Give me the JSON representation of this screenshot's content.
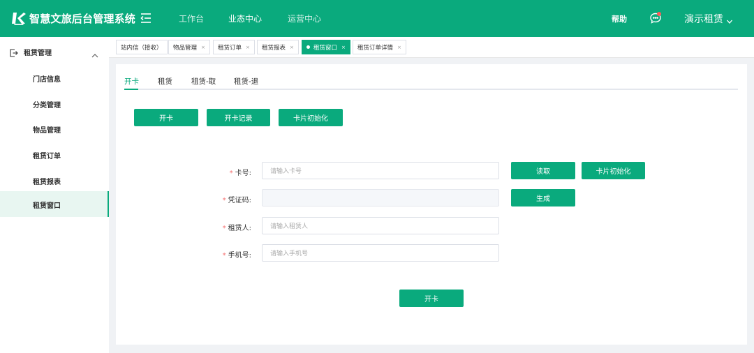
{
  "colors": {
    "brand": "#0aaa7d",
    "required": "#f56c6c",
    "notify_dot": "#ff5a5a"
  },
  "header": {
    "logo_icon": "logo-icon",
    "app_title": "智慧文旅后台管理系统",
    "collapse_icon": "menu-collapse-icon",
    "nav": [
      {
        "label": "工作台"
      },
      {
        "label": "业态中心",
        "active": true
      },
      {
        "label": "运营中心"
      }
    ],
    "help_label": "帮助",
    "message_icon": "message-icon",
    "user_name": "演示租赁",
    "user_caret_icon": "chevron-down-icon"
  },
  "sidebar": {
    "group": {
      "label": "租赁管理",
      "icon": "exit-icon",
      "caret_icon": "chevron-up-icon"
    },
    "items": [
      {
        "label": "门店信息"
      },
      {
        "label": "分类管理"
      },
      {
        "label": "物品管理"
      },
      {
        "label": "租赁订单"
      },
      {
        "label": "租赁报表"
      },
      {
        "label": "租赁窗口",
        "active": true
      }
    ]
  },
  "tabs": [
    {
      "label": "站内信（接收）",
      "closable": false
    },
    {
      "label": "物品管理",
      "closable": true
    },
    {
      "label": "租赁订单",
      "closable": true
    },
    {
      "label": "租赁报表",
      "closable": true
    },
    {
      "label": "租赁窗口",
      "closable": true,
      "active": true
    },
    {
      "label": "租赁订单详情",
      "closable": true
    }
  ],
  "tab_close_glyph": "×",
  "main": {
    "subtabs": [
      {
        "label": "开卡",
        "active": true
      },
      {
        "label": "租赁"
      },
      {
        "label": "租赁-取"
      },
      {
        "label": "租赁-退"
      }
    ],
    "action_buttons": [
      "开卡",
      "开卡记录",
      "卡片初始化"
    ],
    "form": {
      "required_mark": "*",
      "card_no": {
        "label": "卡号:",
        "placeholder": "请输入卡号"
      },
      "voucher": {
        "label": "凭证码:",
        "placeholder": ""
      },
      "renter": {
        "label": "租赁人:",
        "placeholder": "请输入租赁人"
      },
      "phone": {
        "label": "手机号:",
        "placeholder": "请输入手机号"
      },
      "read_button": "读取",
      "init_button": "卡片初始化",
      "generate_button": "生成",
      "submit_button": "开卡"
    }
  }
}
